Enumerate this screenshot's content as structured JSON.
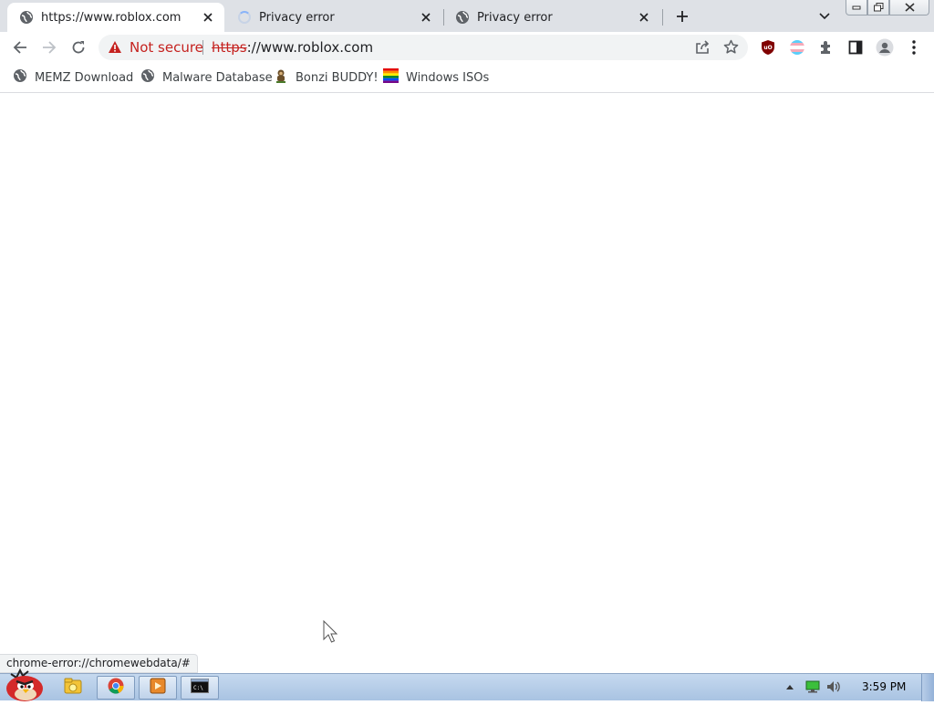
{
  "tabs": [
    {
      "title": "https://www.roblox.com",
      "active": true,
      "favicon": "globe-icon"
    },
    {
      "title": "Privacy error",
      "active": false,
      "favicon": "loading-spinner"
    },
    {
      "title": "Privacy error",
      "active": false,
      "favicon": "globe-icon"
    }
  ],
  "omnibox": {
    "security_label": "Not secure",
    "url_scheme": "https",
    "url_rest": "://www.roblox.com"
  },
  "bookmarks": [
    {
      "label": "MEMZ Download",
      "icon": "globe-icon"
    },
    {
      "label": "Malware Database",
      "icon": "globe-icon"
    },
    {
      "label": "Bonzi BUDDY!",
      "icon": "bonzi-icon"
    },
    {
      "label": "Windows ISOs",
      "icon": "rainbow-flag-icon"
    }
  ],
  "status_bar": {
    "text": "chrome-error://chromewebdata/#"
  },
  "taskbar": {
    "start_icon": "angry-bird-icon",
    "apps": [
      "explorer-icon",
      "chrome-icon",
      "media-icon",
      "cmd-icon"
    ],
    "clock": "3:59 PM"
  },
  "colors": {
    "warning": "#c5221f",
    "tabstrip": "#dee1e6",
    "taskbar": "#b4cbe6"
  }
}
